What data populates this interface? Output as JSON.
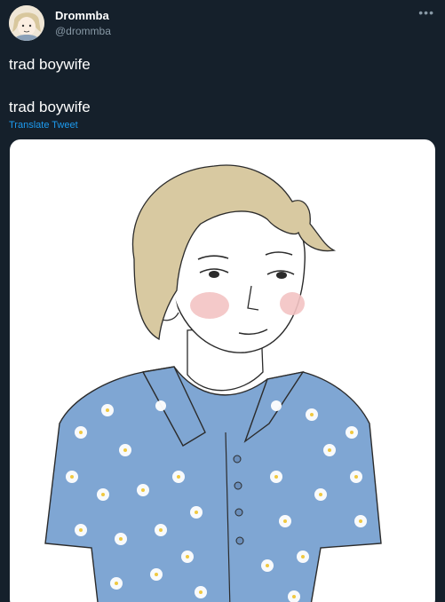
{
  "tweet": {
    "author_name": "Drommba",
    "author_handle": "@drommba",
    "more_icon": "more-horizontal-icon",
    "text_original": "trad boywife",
    "text_translated": "trad boywife",
    "translate_label": "Translate Tweet"
  },
  "colors": {
    "background": "#15202b",
    "text_primary": "#ffffff",
    "text_secondary": "#8899a6",
    "link": "#1d9bf0",
    "shirt_blue": "#7fa6d3",
    "hair_blonde": "#d8c9a1",
    "blush_pink": "#f3c3c3"
  }
}
